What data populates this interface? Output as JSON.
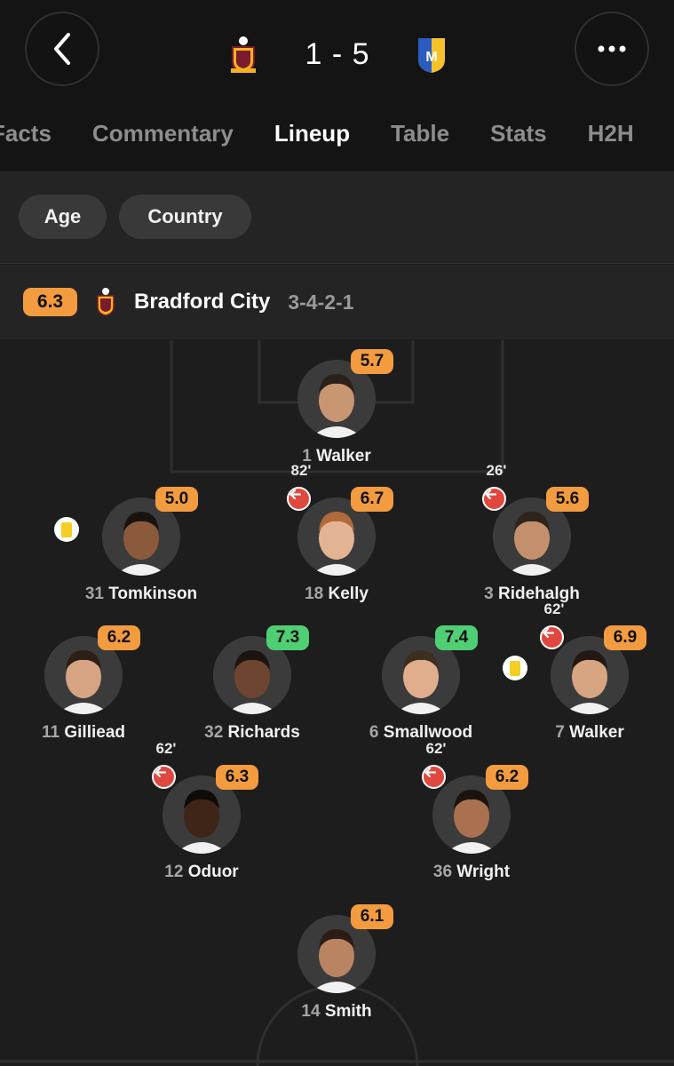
{
  "match": {
    "score": "1 - 5",
    "home_crest": "bradford-city-crest",
    "away_crest": "mansfield-town-crest"
  },
  "tabs": [
    {
      "label": "Facts",
      "active": false
    },
    {
      "label": "Commentary",
      "active": false
    },
    {
      "label": "Lineup",
      "active": true
    },
    {
      "label": "Table",
      "active": false
    },
    {
      "label": "Stats",
      "active": false
    },
    {
      "label": "H2H",
      "active": false
    }
  ],
  "filters": {
    "age": "Age",
    "country": "Country"
  },
  "team": {
    "rating": "6.3",
    "name": "Bradford City",
    "formation": "3-4-2-1"
  },
  "players": [
    {
      "number": "1",
      "name": "Walker",
      "rating": "5.7",
      "rating_color": "orange",
      "sub_minute": null,
      "yellow": false
    },
    {
      "number": "31",
      "name": "Tomkinson",
      "rating": "5.0",
      "rating_color": "orange",
      "sub_minute": null,
      "yellow": true
    },
    {
      "number": "18",
      "name": "Kelly",
      "rating": "6.7",
      "rating_color": "orange",
      "sub_minute": "82'",
      "yellow": false
    },
    {
      "number": "3",
      "name": "Ridehalgh",
      "rating": "5.6",
      "rating_color": "orange",
      "sub_minute": "26'",
      "yellow": false
    },
    {
      "number": "11",
      "name": "Gilliead",
      "rating": "6.2",
      "rating_color": "orange",
      "sub_minute": null,
      "yellow": false
    },
    {
      "number": "32",
      "name": "Richards",
      "rating": "7.3",
      "rating_color": "green",
      "sub_minute": null,
      "yellow": false
    },
    {
      "number": "6",
      "name": "Smallwood",
      "rating": "7.4",
      "rating_color": "green",
      "sub_minute": null,
      "yellow": false
    },
    {
      "number": "7",
      "name": "Walker",
      "rating": "6.9",
      "rating_color": "orange",
      "sub_minute": "62'",
      "yellow": true
    },
    {
      "number": "12",
      "name": "Oduor",
      "rating": "6.3",
      "rating_color": "orange",
      "sub_minute": "62'",
      "yellow": false
    },
    {
      "number": "36",
      "name": "Wright",
      "rating": "6.2",
      "rating_color": "orange",
      "sub_minute": "62'",
      "yellow": false
    },
    {
      "number": "14",
      "name": "Smith",
      "rating": "6.1",
      "rating_color": "orange",
      "sub_minute": null,
      "yellow": false
    }
  ],
  "colors": {
    "rating_orange": "#f39b3f",
    "rating_green": "#4fcf73",
    "sub_off_red": "#e0483f",
    "yellow_card": "#f6cd24"
  }
}
